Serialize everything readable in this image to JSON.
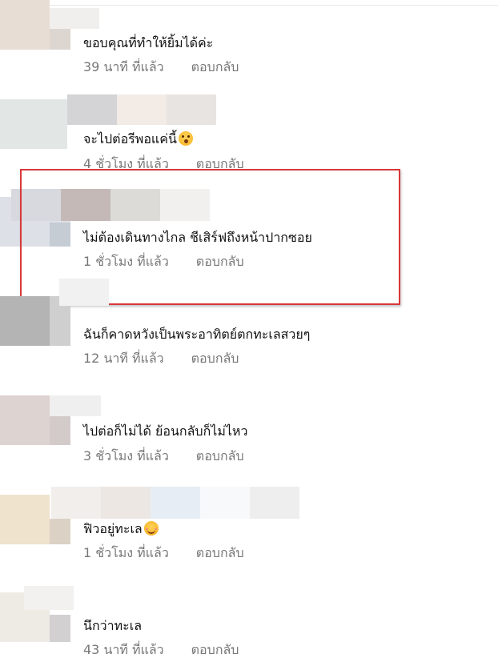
{
  "comments": [
    {
      "text": "ขอบคุณที่ทำให้ยิ้มได้ค่ะ",
      "time": "39 นาที ที่แล้ว",
      "reply": "ตอบกลับ"
    },
    {
      "text": "จะไปต่อรีพอแค่นี้",
      "emoji": "shocked-face-emoji",
      "time": "4 ชั่วโมง ที่แล้ว",
      "reply": "ตอบกลับ"
    },
    {
      "text": "ไม่ต้องเดินทางไกล ชีเสิร์ฟถึงหน้าปากซอย",
      "time": "1 ชั่วโมง ที่แล้ว",
      "reply": "ตอบกลับ"
    },
    {
      "text": "ฉันก็คาดหวังเป็นพระอาทิตย์ตกทะเลสวยๆ",
      "time": "12 นาที ที่แล้ว",
      "reply": "ตอบกลับ"
    },
    {
      "text": "ไปต่อก็ไม่ได้ ย้อนกลับก็ไม่ไหว",
      "time": "3 ชั่วโมง ที่แล้ว",
      "reply": "ตอบกลับ"
    },
    {
      "text": "ฟิวอยู่ทะเล",
      "emoji": "smiling-face-emoji",
      "time": "1 ชั่วโมง ที่แล้ว",
      "reply": "ตอบกลับ"
    },
    {
      "text": "นึกว่าทะเล",
      "time": "43 นาที ที่แล้ว",
      "reply": "ตอบกลับ"
    }
  ],
  "highlight": {
    "color": "#d9383a",
    "comment_index": 2
  },
  "colors": {
    "text": "#111111",
    "meta": "#777777"
  }
}
